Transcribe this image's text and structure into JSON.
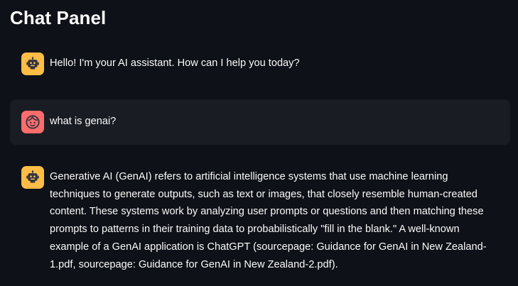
{
  "panel": {
    "title": "Chat Panel"
  },
  "messages": [
    {
      "role": "assistant",
      "avatar_icon": "robot-icon",
      "text": "Hello! I'm your AI assistant. How can I help you today?"
    },
    {
      "role": "user",
      "avatar_icon": "face-icon",
      "text": "what is genai?"
    },
    {
      "role": "assistant",
      "avatar_icon": "robot-icon",
      "text": "Generative AI (GenAI) refers to artificial intelligence systems that use machine learning techniques to generate outputs, such as text or images, that closely resemble human-created content. These systems work by analyzing user prompts or questions and then matching these prompts to patterns in their training data to probabilistically \"fill in the blank.\" A well-known example of a GenAI application is ChatGPT (sourcepage: Guidance for GenAI in New Zealand-1.pdf, sourcepage: Guidance for GenAI in New Zealand-2.pdf)."
    }
  ],
  "colors": {
    "background": "#0e1117",
    "user_bubble": "#1a1c24",
    "assistant_avatar": "#ffbd45",
    "user_avatar": "#ff6c6c",
    "text": "#fafafa"
  }
}
